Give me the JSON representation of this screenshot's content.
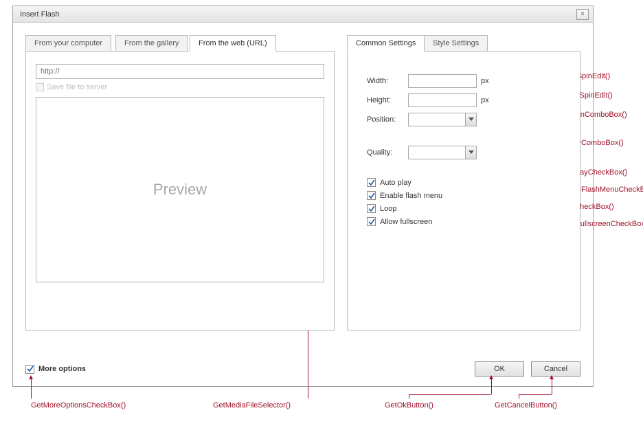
{
  "dialog": {
    "title": "Insert Flash",
    "close_icon": "×"
  },
  "left_tabs": {
    "computer": "From your computer",
    "gallery": "From the gallery",
    "web": "From the web (URL)"
  },
  "left_panel": {
    "url_placeholder": "http://",
    "savefile_label": "Save file to server",
    "preview_text": "Preview"
  },
  "right_tabs": {
    "common": "Common Settings",
    "style": "Style Settings"
  },
  "form": {
    "width_label": "Width:",
    "height_label": "Height:",
    "position_label": "Position:",
    "quality_label": "Quality:",
    "px": "px",
    "autoplay": "Auto play",
    "enablemenu": "Enable flash menu",
    "loop": "Loop",
    "allowfs": "Allow fullscreen"
  },
  "bottom": {
    "more_options": "More options",
    "ok": "OK",
    "cancel": "Cancel"
  },
  "annotations": {
    "width": "GetWidthSpinEdit()",
    "height": "GetHeightSpinEdit()",
    "position": "GetPositionComboBox()",
    "quality": "GetQualityComboBox()",
    "autoplay": "GetAutoPlayCheckBox()",
    "enablemenu": "GetEnableFlashMenuCheckBox()",
    "loop": "GetLoopCheckBox()",
    "allowfs": "GetAllowFullscreenCheckBox()",
    "moreoptions": "GetMoreOptionsCheckBox()",
    "mediafile": "GetMediaFileSelector()",
    "ok": "GetOkButton()",
    "cancel": "GetCancelButton()"
  }
}
